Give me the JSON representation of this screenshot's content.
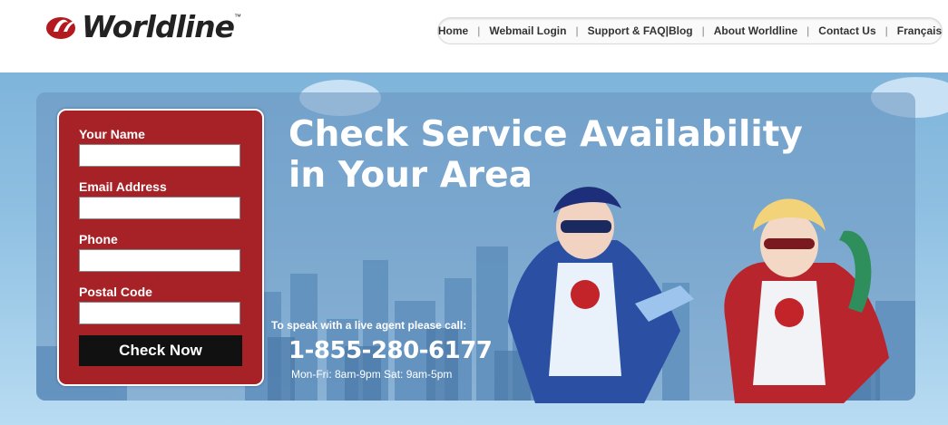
{
  "brand": {
    "name": "Worldline",
    "tm": "™"
  },
  "nav": {
    "items": [
      {
        "label": "Home"
      },
      {
        "label": "Webmail Login"
      },
      {
        "label": "Support & FAQ|Blog"
      },
      {
        "label": "About Worldline"
      },
      {
        "label": "Contact Us"
      },
      {
        "label": "Français"
      }
    ]
  },
  "form": {
    "name_label": "Your Name",
    "email_label": "Email Address",
    "phone_label": "Phone",
    "postal_label": "Postal Code",
    "name_value": "",
    "email_value": "",
    "phone_value": "",
    "postal_value": "",
    "submit_label": "Check Now"
  },
  "hero": {
    "headline_line1": "Check Service Availability",
    "headline_line2": "in Your Area",
    "agent_text": "To speak with a live agent please call:",
    "phone": "1-855-280-6177",
    "hours": "Mon-Fri: 8am-9pm Sat: 9am-5pm"
  },
  "colors": {
    "brand_red": "#a72226",
    "sky_blue": "#7fb4da",
    "button_black": "#111111"
  }
}
